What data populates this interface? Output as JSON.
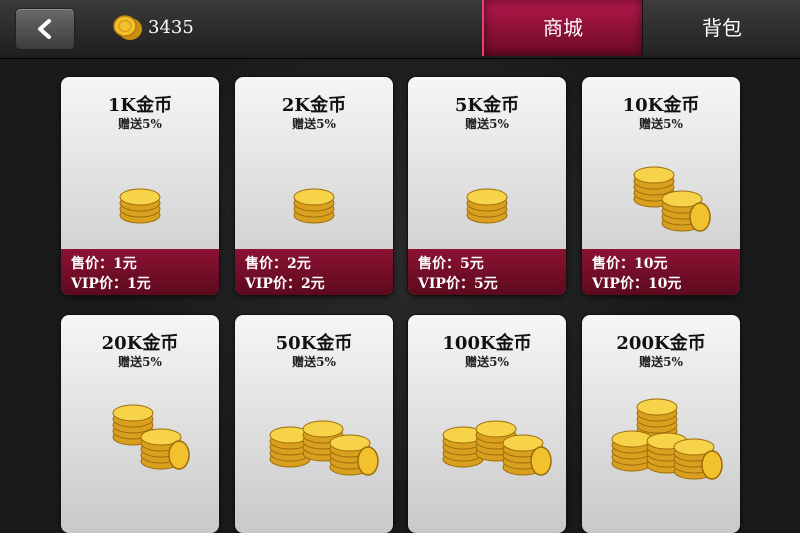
{
  "header": {
    "coin_balance": "3435",
    "tabs": [
      {
        "label": "商城",
        "active": true
      },
      {
        "label": "背包",
        "active": false
      }
    ]
  },
  "colors": {
    "accent": "#8c1233",
    "active_tab": "#b3184a",
    "coin_gold": "#f2c12e"
  },
  "products": [
    {
      "title": "1K金币",
      "bonus": "赠送5%",
      "price": "售价：1元",
      "vip_price": "VIP价：1元",
      "stacks": 1
    },
    {
      "title": "2K金币",
      "bonus": "赠送5%",
      "price": "售价：2元",
      "vip_price": "VIP价：2元",
      "stacks": 1
    },
    {
      "title": "5K金币",
      "bonus": "赠送5%",
      "price": "售价：5元",
      "vip_price": "VIP价：5元",
      "stacks": 1
    },
    {
      "title": "10K金币",
      "bonus": "赠送5%",
      "price": "售价：10元",
      "vip_price": "VIP价：10元",
      "stacks": 2
    },
    {
      "title": "20K金币",
      "bonus": "赠送5%",
      "price": "",
      "vip_price": "",
      "stacks": 2
    },
    {
      "title": "50K金币",
      "bonus": "赠送5%",
      "price": "",
      "vip_price": "",
      "stacks": 3
    },
    {
      "title": "100K金币",
      "bonus": "赠送5%",
      "price": "",
      "vip_price": "",
      "stacks": 3
    },
    {
      "title": "200K金币",
      "bonus": "赠送5%",
      "price": "",
      "vip_price": "",
      "stacks": 4
    }
  ]
}
